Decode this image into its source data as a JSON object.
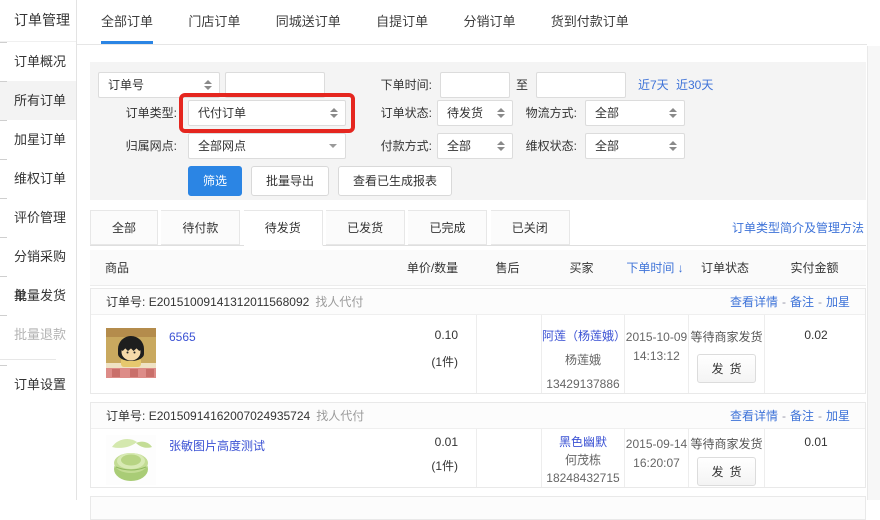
{
  "colors": {
    "accent": "#2b85e4",
    "link": "#3e73d8",
    "product_link": "#3b52d4",
    "annotation_red": "#e5261f"
  },
  "ui": {
    "link_sep": "-",
    "sort_icon": "↓"
  },
  "sidebar": {
    "title": "订单管理",
    "items": [
      {
        "label": "订单概况"
      },
      {
        "label": "所有订单",
        "selected": true
      },
      {
        "label": "加星订单"
      },
      {
        "label": "维权订单"
      },
      {
        "label": "评价管理"
      },
      {
        "label": "分销采购单"
      },
      {
        "label": "批量发货"
      },
      {
        "label": "批量退款",
        "muted": true
      },
      {
        "label": "订单设置"
      }
    ]
  },
  "top_tabs": {
    "items": [
      {
        "label": "全部订单",
        "active": true
      },
      {
        "label": "门店订单"
      },
      {
        "label": "同城送订单"
      },
      {
        "label": "自提订单"
      },
      {
        "label": "分销订单"
      },
      {
        "label": "货到付款订单"
      }
    ]
  },
  "filters": {
    "search_type": "订单号",
    "search_value": "",
    "time_label": "下单时间:",
    "to": "至",
    "date_from": "",
    "date_to": "",
    "quick7": "近7天",
    "quick30": "近30天",
    "order_type_label": "订单类型:",
    "order_type": "代付订单",
    "order_status_label": "订单状态:",
    "order_status": "待发货",
    "logistics_label": "物流方式:",
    "logistics": "全部",
    "branch_label": "归属网点:",
    "branch": "全部网点",
    "payment_label": "付款方式:",
    "payment": "全部",
    "rights_label": "维权状态:",
    "rights": "全部",
    "btn_filter": "筛选",
    "btn_export": "批量导出",
    "btn_report": "查看已生成报表"
  },
  "status_tabs": {
    "tabs": [
      {
        "label": "全部"
      },
      {
        "label": "待付款"
      },
      {
        "label": "待发货",
        "active": true
      },
      {
        "label": "已发货"
      },
      {
        "label": "已完成"
      },
      {
        "label": "已关闭"
      }
    ],
    "help_link": "订单类型简介及管理方法"
  },
  "table": {
    "col_product": "商品",
    "col_price": "单价/数量",
    "col_aftersale": "售后",
    "col_buyer": "买家",
    "col_time": "下单时间",
    "col_status": "订单状态",
    "col_amount": "实付金额"
  },
  "orders": [
    {
      "id_label": "订单号:",
      "id": "E20151009141312011568092",
      "tag": "找人代付",
      "link_detail": "查看详情",
      "link_note": "备注",
      "link_star": "加星",
      "product_name": "6565",
      "price": "0.10",
      "qty": "(1件)",
      "buyer": "阿莲（杨莲娥）",
      "buyer_name": "杨莲娥",
      "buyer_phone": "13429137886",
      "date": "2015-10-09",
      "time": "14:13:12",
      "status": "等待商家发货",
      "action": "发货",
      "amount": "0.02"
    },
    {
      "id_label": "订单号:",
      "id": "E20150914162007024935724",
      "tag": "找人代付",
      "link_detail": "查看详情",
      "link_note": "备注",
      "link_star": "加星",
      "product_name": "张敏图片高度测试",
      "price": "0.01",
      "qty": "(1件)",
      "buyer": "黑色幽默",
      "buyer_name": "何茂栋",
      "buyer_phone": "18248432715",
      "date": "2015-09-14",
      "time": "16:20:07",
      "status": "等待商家发货",
      "action": "发货",
      "amount": "0.01"
    }
  ]
}
